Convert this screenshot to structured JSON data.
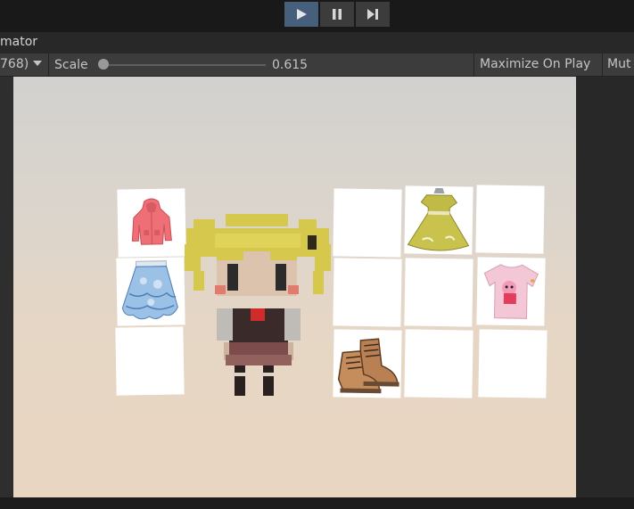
{
  "toolbar": {
    "play_icon": "play-icon",
    "pause_icon": "pause-icon",
    "step_icon": "step-icon",
    "accent": "#46607c"
  },
  "window": {
    "tab_title": "mator"
  },
  "game_toolbar": {
    "resolution": "768)",
    "scale_label": "Scale",
    "scale_value": "0.615",
    "scale_fraction": 0.0,
    "maximize_label": "Maximize On Play",
    "mute_label": "Mut"
  },
  "inventory": {
    "left_slots": [
      {
        "item": "coat-icon"
      },
      {
        "item": "skirt-icon"
      },
      {
        "item": ""
      }
    ],
    "right_slots": [
      {
        "item": ""
      },
      {
        "item": "dress-icon"
      },
      {
        "item": ""
      },
      {
        "item": ""
      },
      {
        "item": ""
      },
      {
        "item": "tshirt-icon"
      },
      {
        "item": "boots-icon"
      },
      {
        "item": ""
      },
      {
        "item": ""
      }
    ]
  }
}
